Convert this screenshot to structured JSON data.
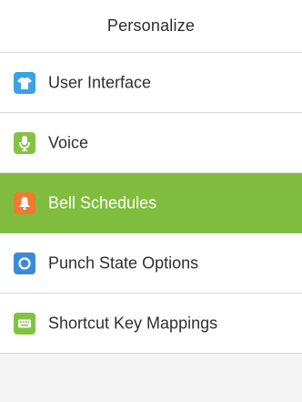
{
  "screen": {
    "title": "Personalize"
  },
  "menu": {
    "items": [
      {
        "label": "User Interface",
        "icon": "shirt-icon",
        "icon_color": "#3da1e2",
        "active": false
      },
      {
        "label": "Voice",
        "icon": "microphone-icon",
        "icon_color": "#82c341",
        "active": false
      },
      {
        "label": "Bell Schedules",
        "icon": "bell-icon",
        "icon_color": "#ef7a32",
        "active": true
      },
      {
        "label": "Punch State Options",
        "icon": "punch-state-icon",
        "icon_color": "#3a8ad8",
        "active": false
      },
      {
        "label": "Shortcut Key Mappings",
        "icon": "keyboard-icon",
        "icon_color": "#82c341",
        "active": false
      }
    ]
  },
  "colors": {
    "active_row": "#80bd3f",
    "divider": "#d6d6d6",
    "background": "#f3f3f3"
  }
}
